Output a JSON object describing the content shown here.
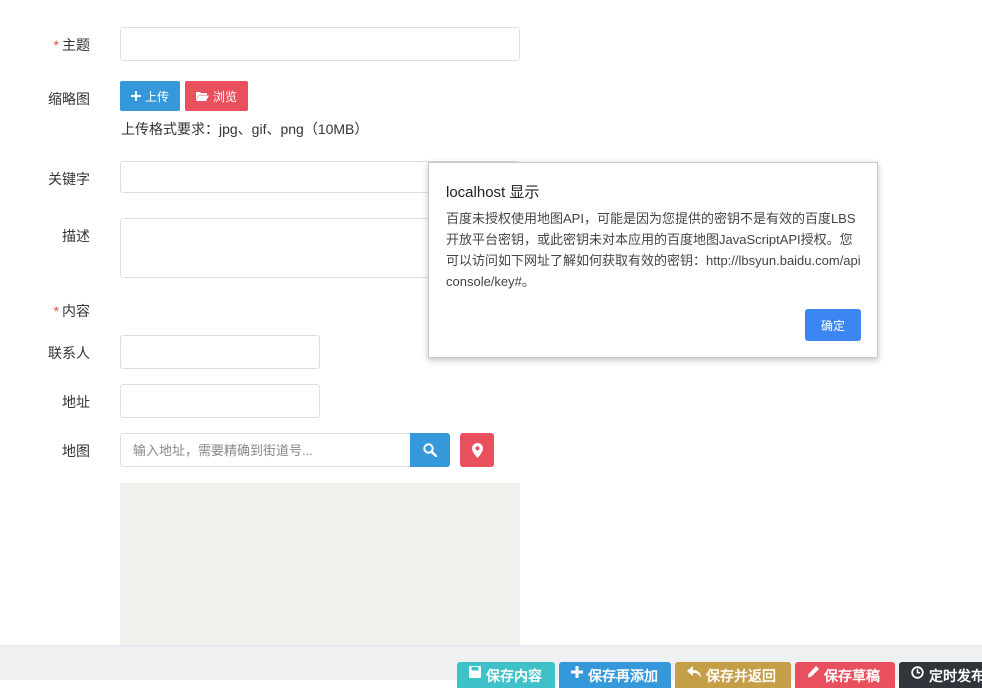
{
  "form": {
    "subject": {
      "required_mark": "*",
      "label": "主题",
      "value": ""
    },
    "thumbnail": {
      "label": "缩略图",
      "upload_label": "上传",
      "browse_label": "浏览",
      "hint": "上传格式要求：jpg、gif、png（10MB）"
    },
    "keywords": {
      "label": "关键字",
      "value": ""
    },
    "description": {
      "label": "描述",
      "value": ""
    },
    "content": {
      "required_mark": "*",
      "label": "内容"
    },
    "contact": {
      "label": "联系人",
      "value": ""
    },
    "address": {
      "label": "地址",
      "value": ""
    },
    "map": {
      "label": "地图",
      "search_placeholder": "输入地址，需要精确到街道号...",
      "search_icon": "search-icon",
      "locate_icon": "map-marker-icon"
    }
  },
  "footer": {
    "buttons": [
      {
        "label": "保存内容",
        "icon": "save-icon",
        "color": "#3fc1c9"
      },
      {
        "label": "保存再添加",
        "icon": "plus-icon",
        "color": "#3498db"
      },
      {
        "label": "保存并返回",
        "icon": "return-icon",
        "color": "#c49f47"
      },
      {
        "label": "保存草稿",
        "icon": "pencil-icon",
        "color": "#e9505e"
      },
      {
        "label": "定时发布",
        "icon": "clock-icon",
        "color": "#2f353b"
      }
    ]
  },
  "dialog": {
    "title": "localhost 显示",
    "message": "百度未授权使用地图API，可能是因为您提供的密钥不是有效的百度LBS开放平台密钥，或此密钥未对本应用的百度地图JavaScriptAPI授权。您可以访问如下网址了解如何获取有效的密钥：http://lbsyun.baidu.com/apiconsole/key#。",
    "ok_label": "确定"
  },
  "colors": {
    "primary_blue": "#3498db",
    "danger_red": "#e9505e",
    "dialog_button": "#3b86f0"
  }
}
